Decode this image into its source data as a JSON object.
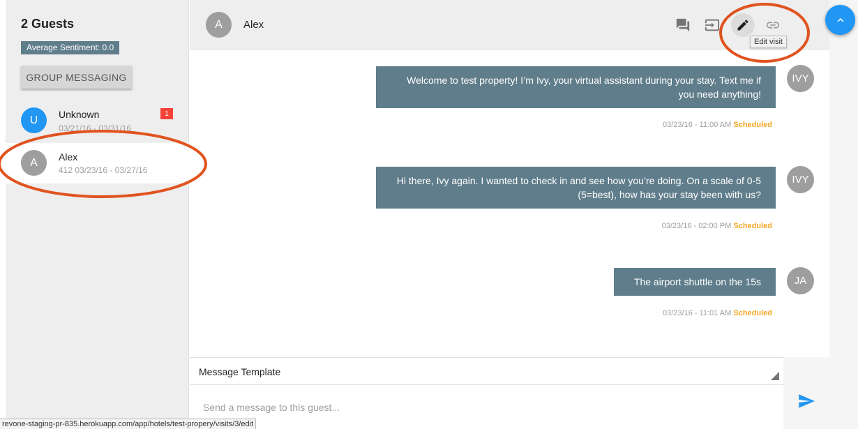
{
  "sidebar": {
    "guest_count": "2 Guests",
    "sentiment": "Average Sentiment: 0.0",
    "group_messaging_label": "GROUP MESSAGING",
    "guests": [
      {
        "initial": "U",
        "name": "Unknown",
        "subtitle": "03/21/16 - 03/31/16",
        "badge": "1",
        "avatar_color": "#2196f3"
      },
      {
        "initial": "A",
        "name": "Alex",
        "subtitle": "412 03/23/16 - 03/27/16",
        "avatar_color": "#9e9e9e"
      }
    ]
  },
  "header": {
    "initial": "A",
    "name": "Alex",
    "icons": [
      "chat-icon",
      "checkout-icon",
      "edit-icon",
      "link-icon"
    ],
    "tooltip": "Edit visit"
  },
  "messages": [
    {
      "text": "Welcome to test property! I’m Ivy, your virtual assistant during your stay. Text me if you need anything!",
      "author_initials": "IVY",
      "timestamp": "03/23/16 - 11:00 AM",
      "status": "Scheduled"
    },
    {
      "text": "Hi there, Ivy again. I wanted to check in and see how you’re doing. On a scale of 0-5 (5=best), how has your stay been with us?",
      "author_initials": "IVY",
      "timestamp": "03/23/16 - 02:00 PM",
      "status": "Scheduled"
    },
    {
      "text": "The airport shuttle on the 15s",
      "author_initials": "JA",
      "timestamp": "03/23/16 - 11:01 AM",
      "status": "Scheduled"
    }
  ],
  "composer": {
    "template_label": "Message Template",
    "placeholder": "Send a message to this guest..."
  },
  "status_bar_url": "revone-staging-pr-835.herokuapp.com/app/hotels/test-propery/visits/3/edit",
  "colors": {
    "accent": "#2196f3",
    "bubble": "#607d8b",
    "scheduled": "#f5a623",
    "badge": "#f44336",
    "annotation": "#e0531f"
  }
}
